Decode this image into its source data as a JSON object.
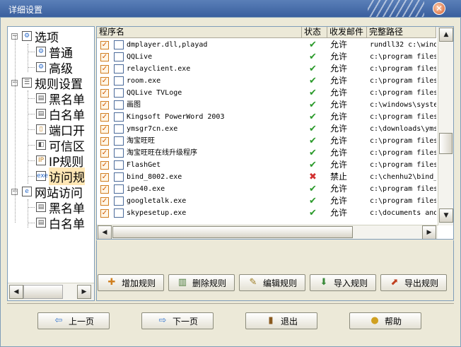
{
  "window": {
    "title": "详细设置"
  },
  "tree": [
    {
      "label": "选项",
      "icon": "gear-icon",
      "level": 0,
      "expanded": true
    },
    {
      "label": "普通",
      "icon": "gear-icon",
      "level": 1
    },
    {
      "label": "高级",
      "icon": "gear-icon",
      "level": 1
    },
    {
      "label": "规则设置",
      "icon": "rules-icon",
      "level": 0,
      "expanded": true
    },
    {
      "label": "黑名单",
      "icon": "list-icon",
      "level": 1
    },
    {
      "label": "白名单",
      "icon": "list-icon",
      "level": 1
    },
    {
      "label": "端口开",
      "icon": "port-icon",
      "level": 1
    },
    {
      "label": "可信区",
      "icon": "network-icon",
      "level": 1
    },
    {
      "label": "IP规则",
      "icon": "ip-icon",
      "level": 1
    },
    {
      "label": "访问规",
      "icon": "exe-icon",
      "level": 1,
      "selected": true
    },
    {
      "label": "网站访问",
      "icon": "web-icon",
      "level": 0,
      "expanded": true
    },
    {
      "label": "黑名单",
      "icon": "list-icon",
      "level": 1
    },
    {
      "label": "白名单",
      "icon": "list-icon",
      "level": 1
    }
  ],
  "table": {
    "headers": [
      "程序名",
      "状态",
      "收发邮件",
      "完整路径"
    ],
    "rows": [
      {
        "name": "dmplayer.dll,playad",
        "status": "allow",
        "perm": "允许",
        "path": "rundll32 c:\\wind"
      },
      {
        "name": "QQLive",
        "status": "allow",
        "perm": "允许",
        "path": "c:\\program files"
      },
      {
        "name": "relayclient.exe",
        "status": "allow",
        "perm": "允许",
        "path": "c:\\program files"
      },
      {
        "name": "room.exe",
        "status": "allow",
        "perm": "允许",
        "path": "c:\\program files"
      },
      {
        "name": "QQLive TVLoge",
        "status": "allow",
        "perm": "允许",
        "path": "c:\\program files"
      },
      {
        "name": "画图",
        "status": "allow",
        "perm": "允许",
        "path": "c:\\windows\\syste"
      },
      {
        "name": "Kingsoft PowerWord 2003",
        "status": "allow",
        "perm": "允许",
        "path": "c:\\program files"
      },
      {
        "name": "ymsgr7cn.exe",
        "status": "allow",
        "perm": "允许",
        "path": "c:\\downloads\\yms"
      },
      {
        "name": "淘宝旺旺",
        "status": "allow",
        "perm": "允许",
        "path": "c:\\program files"
      },
      {
        "name": "淘宝旺旺在线升级程序",
        "status": "allow",
        "perm": "允许",
        "path": "c:\\program files"
      },
      {
        "name": "FlashGet",
        "status": "allow",
        "perm": "允许",
        "path": "c:\\program files"
      },
      {
        "name": "bind_8002.exe",
        "status": "deny",
        "perm": "禁止",
        "path": "c:\\chenhu2\\bind_"
      },
      {
        "name": "ipe40.exe",
        "status": "allow",
        "perm": "允许",
        "path": "c:\\program files"
      },
      {
        "name": "googletalk.exe",
        "status": "allow",
        "perm": "允许",
        "path": "c:\\program files"
      },
      {
        "name": "skypesetup.exe",
        "status": "allow",
        "perm": "允许",
        "path": "c:\\documents and"
      }
    ]
  },
  "actions": {
    "add": "增加规则",
    "delete": "删除规则",
    "edit": "编辑规则",
    "import": "导入规则",
    "export": "导出规则"
  },
  "nav": {
    "prev": "上一页",
    "next": "下一页",
    "exit": "退出",
    "help": "帮助"
  },
  "glyphs": {
    "check": "✔",
    "cross": "✖",
    "checkbox": "✓",
    "close": "✕"
  },
  "colors": {
    "allow": "#2b9a2b",
    "deny": "#d23030",
    "title_bar": "#3a5f9e"
  }
}
